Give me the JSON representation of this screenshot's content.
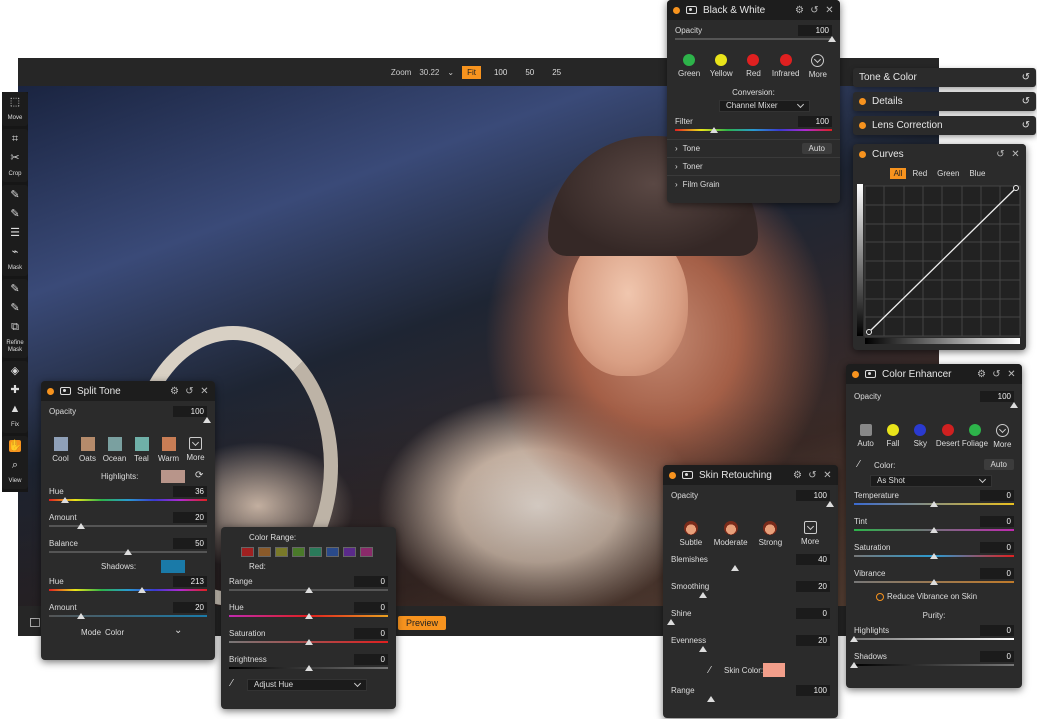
{
  "toolbar": {
    "zoom_label": "Zoom",
    "zoom_value": "30.22",
    "zoom_buttons": [
      "Fit",
      "100",
      "50",
      "25"
    ],
    "preview_label": "Preview"
  },
  "sidebar": {
    "groups": [
      {
        "label": "Move"
      },
      {
        "label": "Crop"
      },
      {
        "label": "Mask"
      },
      {
        "label": "Refine Mask"
      },
      {
        "label": "Fix"
      },
      {
        "label": "View"
      }
    ]
  },
  "bw": {
    "title": "Black & White",
    "opacity_label": "Opacity",
    "opacity_value": "100",
    "opacity_level": 1.0,
    "filters": [
      {
        "name": "Green",
        "color": "#2db34a"
      },
      {
        "name": "Yellow",
        "color": "#e9e41a"
      },
      {
        "name": "Red",
        "color": "#e02020"
      },
      {
        "name": "Infrared",
        "color": "#e02020"
      },
      {
        "name": "More",
        "color": ""
      }
    ],
    "conversion_label": "Conversion:",
    "conversion_value": "Channel Mixer",
    "filter_label": "Filter",
    "filter_value": "100",
    "filter_level": 0.25,
    "sections": [
      "Tone",
      "Toner",
      "Film Grain"
    ],
    "auto_label": "Auto"
  },
  "right_tabs": [
    "Tone & Color",
    "Details",
    "Lens Correction"
  ],
  "curves": {
    "title": "Curves",
    "channels": [
      "All",
      "Red",
      "Green",
      "Blue"
    ]
  },
  "split": {
    "title": "Split Tone",
    "opacity_label": "Opacity",
    "opacity_value": "100",
    "opacity_level": 1.0,
    "presets": [
      {
        "name": "Cool",
        "color": "#8fa0b8"
      },
      {
        "name": "Oats",
        "color": "#b58b6b"
      },
      {
        "name": "Ocean",
        "color": "#7aa0a0"
      },
      {
        "name": "Teal",
        "color": "#6fb0a8"
      },
      {
        "name": "Warm",
        "color": "#c87d55"
      },
      {
        "name": "More",
        "color": ""
      }
    ],
    "highlights_label": "Highlights:",
    "highlights_color": "#b8958a",
    "hue_label": "Hue",
    "hue_value": "36",
    "hue_level": 0.1,
    "amount_label": "Amount",
    "amount_value": "20",
    "amount_level": 0.2,
    "balance_label": "Balance",
    "balance_value": "50",
    "balance_level": 0.5,
    "shadows_label": "Shadows:",
    "shadows_color": "#1a7aa8",
    "hue2_label": "Hue",
    "hue2_value": "213",
    "hue2_level": 0.59,
    "amount2_label": "Amount",
    "amount2_value": "20",
    "amount2_level": 0.2,
    "mode_label": "Mode",
    "mode_value": "Color"
  },
  "hsl": {
    "color_range_label": "Color Range:",
    "swatches": [
      "#a02020",
      "#8a5a2a",
      "#7a7a2a",
      "#4a7a2a",
      "#2a7a5a",
      "#2a4a8a",
      "#5a2a8a",
      "#8a2a6a"
    ],
    "channel_label": "Red:",
    "range_label": "Range",
    "range_value": "0",
    "range_level": 0.5,
    "hue_label": "Hue",
    "hue_value": "0",
    "hue_level": 0.5,
    "sat_label": "Saturation",
    "sat_value": "0",
    "sat_level": 0.5,
    "bright_label": "Brightness",
    "bright_value": "0",
    "bright_level": 0.5,
    "adjust_label": "Adjust Hue"
  },
  "skin": {
    "title": "Skin Retouching",
    "opacity_label": "Opacity",
    "opacity_value": "100",
    "opacity_level": 1.0,
    "presets": [
      "Subtle",
      "Moderate",
      "Strong",
      "More"
    ],
    "blemishes_label": "Blemishes",
    "blemishes_value": "40",
    "blemishes_level": 0.4,
    "smoothing_label": "Smoothing",
    "smoothing_value": "20",
    "smoothing_level": 0.2,
    "shine_label": "Shine",
    "shine_value": "0",
    "shine_level": 0.0,
    "evenness_label": "Evenness",
    "evenness_value": "20",
    "evenness_level": 0.2,
    "skin_color_label": "Skin Color:",
    "skin_color": "#f29e8a",
    "range_label": "Range",
    "range_value": "100",
    "range_level": 0.25
  },
  "enhancer": {
    "title": "Color Enhancer",
    "opacity_label": "Opacity",
    "opacity_value": "100",
    "opacity_level": 1.0,
    "presets": [
      {
        "name": "Auto",
        "color": "#888888"
      },
      {
        "name": "Fall",
        "color": "#e9e41a"
      },
      {
        "name": "Sky",
        "color": "#2a3ad0"
      },
      {
        "name": "Desert",
        "color": "#d02020"
      },
      {
        "name": "Foliage",
        "color": "#2db34a"
      },
      {
        "name": "More",
        "color": ""
      }
    ],
    "color_label": "Color:",
    "auto_label": "Auto",
    "as_shot": "As Shot",
    "temp_label": "Temperature",
    "temp_value": "0",
    "temp_level": 0.5,
    "tint_label": "Tint",
    "tint_value": "0",
    "tint_level": 0.5,
    "sat_label": "Saturation",
    "sat_value": "0",
    "sat_level": 0.5,
    "vib_label": "Vibrance",
    "vib_value": "0",
    "vib_level": 0.5,
    "reduce_label": "Reduce Vibrance on Skin",
    "purity_label": "Purity:",
    "hi_label": "Highlights",
    "hi_value": "0",
    "hi_level": 0.0,
    "sh_label": "Shadows",
    "sh_value": "0",
    "sh_level": 0.0
  }
}
